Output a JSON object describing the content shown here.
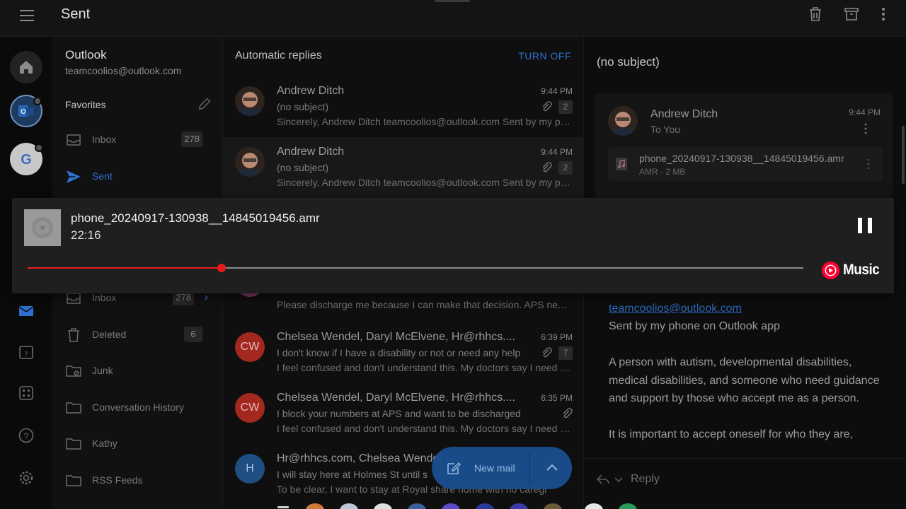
{
  "topbar": {
    "title": "Sent",
    "icons": [
      "hamburger-menu-icon",
      "trash-icon",
      "archive-icon",
      "more-vertical-icon"
    ]
  },
  "rail": {
    "accounts": [
      "outlook-account",
      "google-account"
    ],
    "icons": [
      "home-icon",
      "mail-icon",
      "calendar-icon",
      "apps-icon",
      "help-icon",
      "settings-icon"
    ]
  },
  "folders": {
    "account_name": "Outlook",
    "account_email": "teamcoolios@outlook.com",
    "favorites_label": "Favorites",
    "items": [
      {
        "label": "Inbox",
        "count": "278"
      },
      {
        "label": "Sent",
        "count": ""
      },
      {
        "label": "Inbox",
        "count": "278"
      },
      {
        "label": "Deleted",
        "count": "6"
      },
      {
        "label": "Junk",
        "count": ""
      },
      {
        "label": "Conversation History",
        "count": ""
      },
      {
        "label": "Kathy",
        "count": ""
      },
      {
        "label": "RSS Feeds",
        "count": ""
      }
    ]
  },
  "list": {
    "header": "Automatic replies",
    "turn_off": "TURN OFF",
    "messages": [
      {
        "from": "Andrew Ditch",
        "time": "9:44 PM",
        "subject": "(no subject)",
        "preview": "Sincerely, Andrew Ditch teamcoolios@outlook.com Sent by my phone on Outlook app",
        "count": "2",
        "initials": ""
      },
      {
        "from": "Andrew Ditch",
        "time": "9:44 PM",
        "subject": "(no subject)",
        "preview": "Sincerely, Andrew Ditch teamcoolios@outlook.com Sent by my phone on Outlook app",
        "count": "2",
        "initials": ""
      },
      {
        "from": "",
        "time": "",
        "subject": "",
        "preview": "Please discharge me because I can make that decision. APS needs to back off",
        "count": "",
        "initials": ""
      },
      {
        "from": "Chelsea Wendel, Daryl McElvene, Hr@rhhcs....",
        "time": "6:39 PM",
        "subject": "I don't know if I have a disability or not or need any help",
        "preview": "I feel confused and don't understand this. My doctors say I need help",
        "count": "7",
        "initials": "CW"
      },
      {
        "from": "Chelsea Wendel, Daryl McElvene, Hr@rhhcs....",
        "time": "6:35 PM",
        "subject": "I block your numbers at APS and want to be discharged",
        "preview": "I feel confused and don't understand this. My doctors say I need help",
        "count": "",
        "initials": "CW"
      },
      {
        "from": "Hr@rhhcs.com, Chelsea Wendel",
        "time": "",
        "subject": "I will stay here at Holmes St until s",
        "preview": "To be clear, I want to stay at Royal share home with no caregi",
        "count": "",
        "initials": "H"
      }
    ],
    "new_mail": "New mail"
  },
  "reading": {
    "subject": "(no subject)",
    "from": "Andrew Ditch",
    "to": "To You",
    "time": "9:44 PM",
    "attachment_name": "phone_20240917-130938__14845019456.amr",
    "attachment_meta": "AMR - 2 MB",
    "body_name": "Andrew Ditch",
    "body_link": "teamcoolios@outlook.com",
    "body_sent": "Sent by my phone on Outlook app",
    "body_p1": "A person with autism, developmental disabilities, medical disabilities, and someone who need guidance and support by those who accept me as a person.",
    "body_p2": "It is important to accept oneself for who they are,",
    "reply": "Reply"
  },
  "player": {
    "file_name": "phone_20240917-130938__14845019456.amr",
    "time": "22:16",
    "progress": 0.25,
    "brand": "Music",
    "colors": {
      "progress": "#e61d1d",
      "track": "#8a8a8a",
      "brand": "#ff0033"
    }
  },
  "colors": {
    "accent": "#2f6fd1",
    "fab": "#1a4f8f",
    "avatar_red": "#a3281f",
    "avatar_blue": "#1f4f82"
  }
}
